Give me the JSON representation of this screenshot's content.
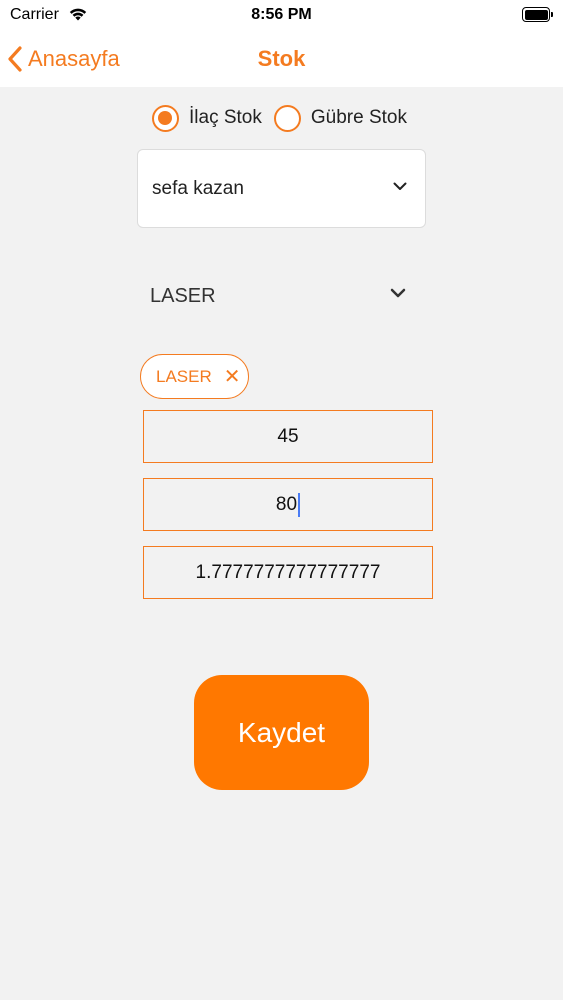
{
  "status_bar": {
    "carrier": "Carrier",
    "time": "8:56 PM"
  },
  "nav": {
    "back_label": "Anasayfa",
    "title": "Stok"
  },
  "radio_options": [
    {
      "label": "İlaç Stok",
      "checked": true
    },
    {
      "label": "Gübre Stok",
      "checked": false
    }
  ],
  "person_select": {
    "value": "sefa kazan"
  },
  "product_select": {
    "value": "LASER"
  },
  "selected_chip": {
    "label": "LASER",
    "remove_glyph": "✕"
  },
  "fields": {
    "field1": "45",
    "field2": "80",
    "field3": "1.7777777777777777"
  },
  "save_button": {
    "label": "Kaydet"
  },
  "colors": {
    "accent": "#f47b20",
    "button": "#ff7800",
    "background": "#f2f2f2",
    "caret": "#4a7cf5"
  },
  "icons": [
    "wifi-icon",
    "battery-icon",
    "back-chevron-icon",
    "chevron-down-icon",
    "close-icon"
  ]
}
